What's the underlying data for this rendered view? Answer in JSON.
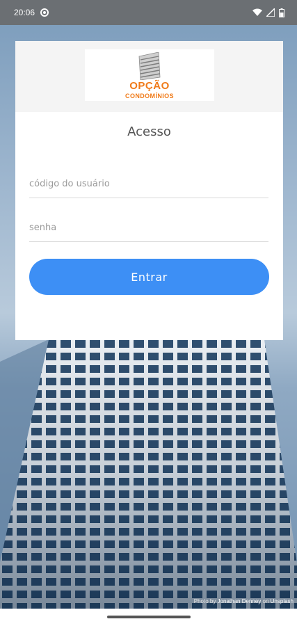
{
  "status_bar": {
    "time": "20:06",
    "icons": [
      "location-circle-icon",
      "wifi-icon",
      "signal-icon",
      "battery-icon"
    ]
  },
  "logo": {
    "line1": "OPÇÃO",
    "line2": "CONDOMÍNIOS",
    "color": "#f07a18"
  },
  "login": {
    "title": "Acesso",
    "user_placeholder": "código do usuário",
    "user_value": "",
    "password_placeholder": "senha",
    "password_value": "",
    "submit_label": "Entrar",
    "accent": "#3d8ff5"
  },
  "credit": {
    "prefix": "Photo by",
    "author": "Jonathan Denney",
    "middle": "on",
    "site": "Unsplash"
  }
}
